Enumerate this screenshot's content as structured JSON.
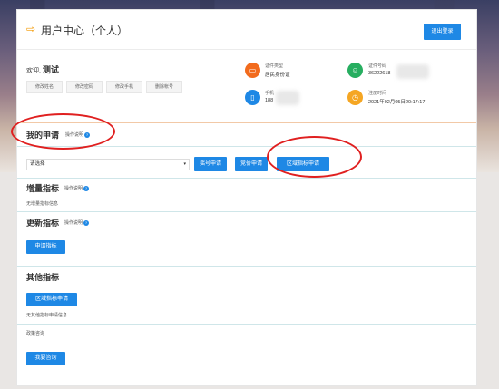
{
  "header": {
    "title": "用户中心（个人）",
    "logout_label": "退出登录"
  },
  "profile": {
    "welcome_prefix": "欢迎,",
    "user_name": "测试",
    "actions": [
      "修改姓名",
      "修改密码",
      "修改手机",
      "删除帐号"
    ],
    "id_type_label": "证件类型",
    "id_type_value": "居民身份证",
    "id_number_label": "证件号码",
    "id_number_value": "36222618",
    "phone_label": "手机",
    "phone_value": "188",
    "register_label": "注册时间",
    "register_value": "2021年02月05日20:17:17"
  },
  "my_applications": {
    "title": "我的申请",
    "help": "操作说明",
    "select_value": "请选择",
    "buttons": [
      "摇号申请",
      "竞价申请",
      "区域指标申请"
    ]
  },
  "increment_quota": {
    "title": "增量指标",
    "help": "操作说明",
    "empty_text": "无增量指标信息"
  },
  "update_quota": {
    "title": "更新指标",
    "help": "操作说明",
    "button": "申请指标"
  },
  "other_quota": {
    "title": "其他指标",
    "button": "区域指标申请",
    "empty_text": "无其他指标申请信息"
  },
  "policy": {
    "title": "政策咨询",
    "button": "我要咨询"
  },
  "colors": {
    "accent": "#1e88e5",
    "orange": "#f39800",
    "red_annotation": "#e02020"
  }
}
